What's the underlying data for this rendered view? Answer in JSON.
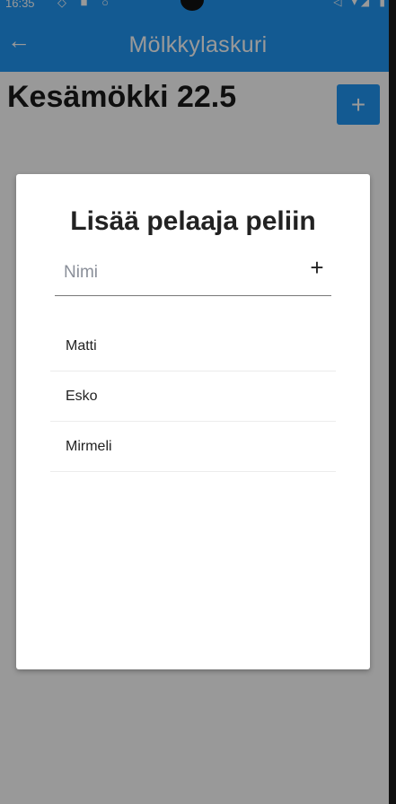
{
  "status_bar": {
    "time": "16:35",
    "left_icons": "◇ ■ ○",
    "right_icons": "◁ ▾◢ ▮"
  },
  "app_bar": {
    "title": "Mölkkylaskuri",
    "back_icon": "←"
  },
  "game": {
    "title": "Kesämökki 22.5",
    "add_button_label": "+"
  },
  "modal": {
    "title": "Lisää pelaaja peliin",
    "input": {
      "placeholder": "Nimi",
      "value": ""
    },
    "add_icon": "+",
    "players": [
      {
        "name": "Matti"
      },
      {
        "name": "Esko"
      },
      {
        "name": "Mirmeli"
      }
    ]
  },
  "colors": {
    "primary": "#2196F3",
    "backdrop": "rgba(0,0,0,0.40)"
  }
}
